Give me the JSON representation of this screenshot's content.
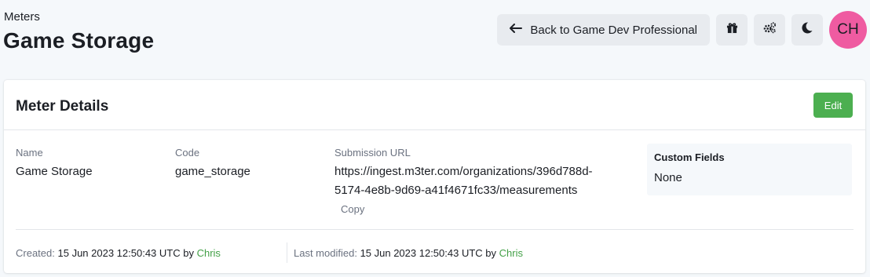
{
  "header": {
    "breadcrumb": "Meters",
    "title": "Game Storage"
  },
  "toolbar": {
    "back_label": "Back to Game Dev Professional",
    "back_icon": "arrow-left-icon",
    "gift_icon": "gift-icon",
    "settings_icon": "gears-icon",
    "theme_icon": "moon-icon",
    "avatar_initials": "CH"
  },
  "card": {
    "title": "Meter Details",
    "edit_label": "Edit",
    "fields": {
      "name_label": "Name",
      "name_value": "Game Storage",
      "code_label": "Code",
      "code_value": "game_storage",
      "url_label": "Submission URL",
      "url_value": "https://ingest.m3ter.com/organizations/396d788d-5174-4e8b-9d69-a41f4671fc33/measurements",
      "copy_label": "Copy"
    },
    "custom_fields": {
      "title": "Custom Fields",
      "value": "None"
    },
    "footer": {
      "created_label": "Created:",
      "created_value": "15 Jun 2023 12:50:43 UTC",
      "created_by": "by",
      "created_user": "Chris",
      "modified_label": "Last modified:",
      "modified_value": "15 Jun 2023 12:50:43 UTC",
      "modified_by": "by",
      "modified_user": "Chris"
    }
  },
  "colors": {
    "background": "#f5f8fb",
    "edit_button": "#4caf50",
    "avatar": "#ef5ba1",
    "user_link": "#43a047"
  }
}
